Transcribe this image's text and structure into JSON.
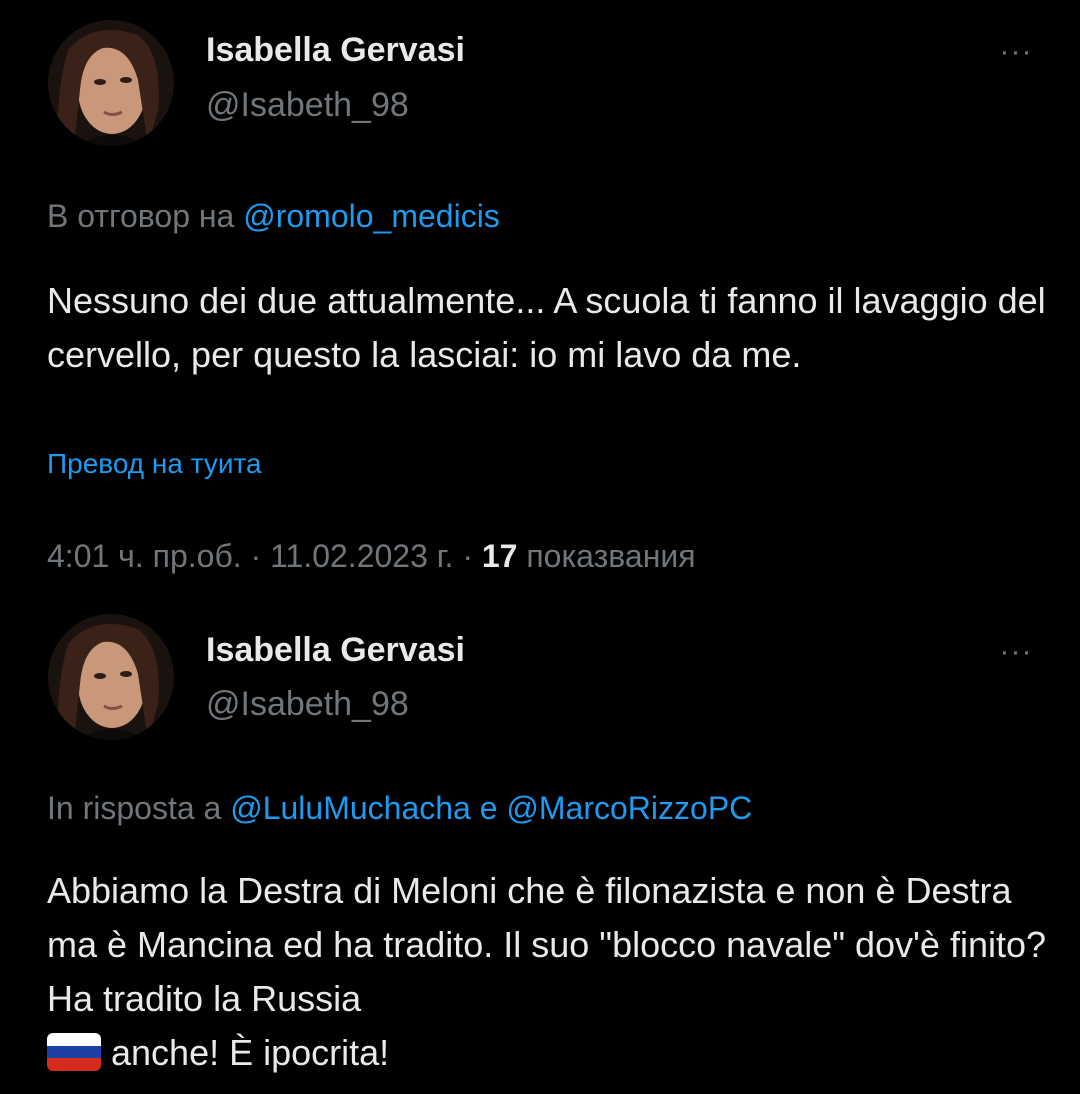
{
  "tweets": [
    {
      "author_name": "Isabella Gervasi",
      "author_handle": "@Isabeth_98",
      "more_label": "···",
      "reply_prefix": "В отговор на ",
      "reply_mentions": [
        "@romolo_medicis"
      ],
      "text": "Nessuno dei due attualmente... A scuola ti fanno il lavaggio del cervello, per questo la lasciai: io mi lavo da me.",
      "translate_label": "Превод на туита",
      "time": "4:01 ч. пр.об.",
      "date": "11.02.2023 г.",
      "views_count": "17",
      "views_label": "показвания",
      "separator": " · "
    },
    {
      "author_name": "Isabella Gervasi",
      "author_handle": "@Isabeth_98",
      "more_label": "···",
      "reply_prefix": "In risposta a ",
      "reply_mentions": [
        "@LuluMuchacha",
        "@MarcoRizzoPC"
      ],
      "reply_conjunction": " e ",
      "text": "Abbiamo la Destra di Meloni che è filonazista e non è Destra ma è Mancina ed ha tradito. Il suo \"blocco navale\" dov'è finito? Ha tradito la Russia",
      "text_after_flag": "anche! È ipocrita!",
      "flag_emoji": "russia-flag",
      "flag_colors": [
        "#ffffff",
        "#1c3fa8",
        "#d52b1e"
      ]
    }
  ],
  "colors": {
    "background": "#000000",
    "primary_text": "#e7e9ea",
    "secondary_text": "#71767b",
    "accent": "#1d9bf0"
  }
}
